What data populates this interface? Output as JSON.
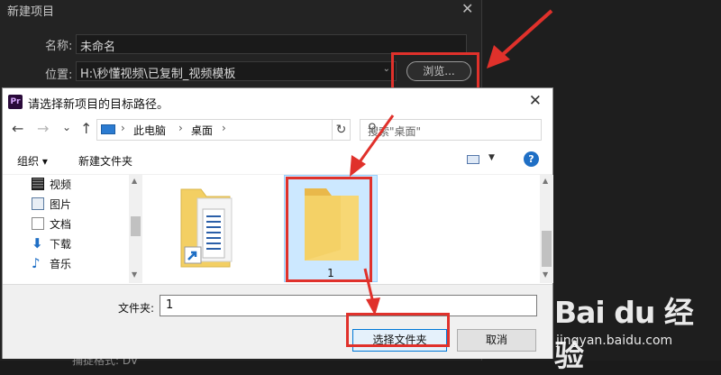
{
  "pr_dialog": {
    "title": "新建项目",
    "close": "✕",
    "name_label": "名称:",
    "name_value": "未命名",
    "location_label": "位置:",
    "location_value": "H:\\秒懂视频\\已复制_视频模板",
    "browse_label": "浏览...",
    "bottom_partial": "捕捉格式: DV"
  },
  "file_chooser": {
    "app_icon": "Pr",
    "title": "请选择新项目的目标路径。",
    "close": "✕",
    "nav": {
      "back": "←",
      "forward": "→",
      "recent": "⌄",
      "up": "↑"
    },
    "address": {
      "pc": "此电脑",
      "sep": "›",
      "desktop": "桌面",
      "refresh": "↻"
    },
    "search_placeholder": "搜索\"桌面\"",
    "toolbar": {
      "organize": "组织 ▾",
      "new_folder": "新建文件夹",
      "help": "?"
    },
    "nav_items": [
      {
        "label": "视频",
        "icon": "video-icon"
      },
      {
        "label": "图片",
        "icon": "picture-icon"
      },
      {
        "label": "文档",
        "icon": "document-icon"
      },
      {
        "label": "下载",
        "icon": "download-icon"
      },
      {
        "label": "音乐",
        "icon": "music-icon"
      }
    ],
    "selected_folder_name": "1",
    "folder_field_label": "文件夹:",
    "folder_field_value": "1",
    "select_button": "选择文件夹",
    "cancel_button": "取消"
  },
  "watermark": {
    "brand": "Bai du 经验",
    "url": "jingyan.baidu.com"
  },
  "colors": {
    "highlight": "#e0312b",
    "selection": "#cce8ff",
    "folder": "#f3cf63",
    "dark_bg": "#232323"
  }
}
